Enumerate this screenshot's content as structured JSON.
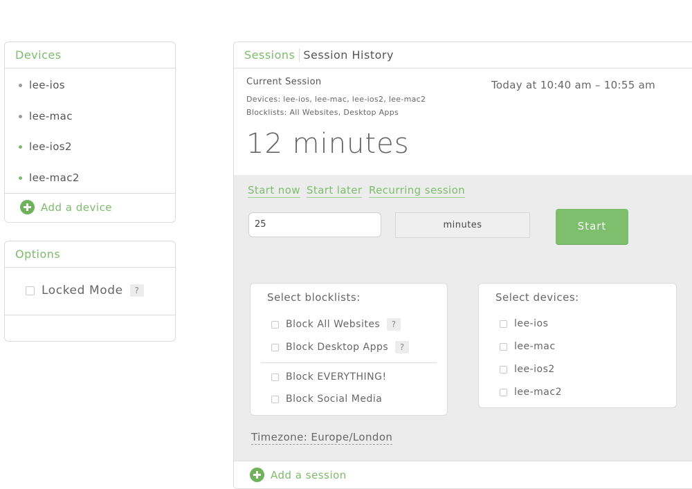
{
  "devices": {
    "title": "Devices",
    "items": [
      {
        "name": "lee-ios",
        "status_color": "#999999"
      },
      {
        "name": "lee-mac",
        "status_color": "#999999"
      },
      {
        "name": "lee-ios2",
        "status_color": "#7cbd6a"
      },
      {
        "name": "lee-mac2",
        "status_color": "#7cbd6a"
      }
    ],
    "add_label": "Add a device"
  },
  "options": {
    "title": "Options",
    "locked_mode_label": "Locked Mode",
    "help_label": "?"
  },
  "sessions": {
    "tabs": [
      {
        "label": "Sessions",
        "active": true
      },
      {
        "label": "Session History",
        "active": false
      }
    ],
    "current": {
      "heading": "Current Session",
      "time_range": "Today at 10:40 am – 10:55 am",
      "devices_line": "Devices: lee-ios, lee-mac, lee-ios2, lee-mac2",
      "blocklists_line": "Blocklists: All Websites, Desktop Apps",
      "remaining": "12 minutes"
    },
    "modes": [
      "Start now",
      "Start later",
      "Recurring session"
    ],
    "duration_value": "25",
    "duration_unit": "minutes",
    "start_label": "Start",
    "blocklists": {
      "title": "Select blocklists:",
      "items": [
        {
          "label": "Block All Websites",
          "help": "?"
        },
        {
          "label": "Block Desktop Apps",
          "help": "?"
        },
        {
          "label": "Block EVERYTHING!"
        },
        {
          "label": "Block Social Media"
        }
      ]
    },
    "devices_select": {
      "title": "Select devices:",
      "items": [
        "lee-ios",
        "lee-mac",
        "lee-ios2",
        "lee-mac2"
      ]
    },
    "timezone": "Timezone: Europe/London",
    "add_session_label": "Add a session"
  },
  "colors": {
    "accent": "#7cbd6a",
    "panel_bg": "#ececec",
    "border": "#dcdcdc"
  }
}
